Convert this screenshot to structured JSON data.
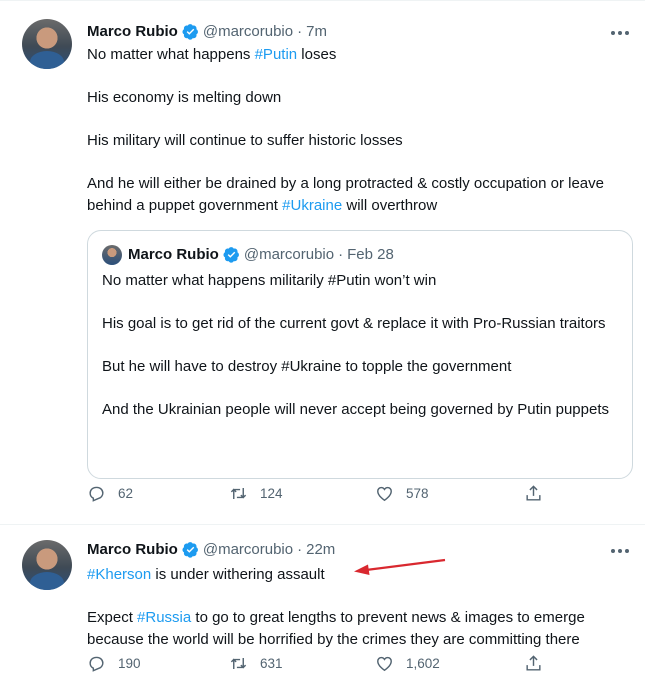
{
  "tweets": [
    {
      "author": {
        "name": "Marco Rubio",
        "handle": "@marcorubio",
        "time": "7m"
      },
      "lines": [
        {
          "parts": [
            {
              "t": "No matter what happens "
            },
            {
              "t": "#Putin",
              "link": true
            },
            {
              "t": " loses"
            }
          ]
        },
        {
          "parts": [
            {
              "t": "His economy is melting down"
            }
          ]
        },
        {
          "parts": [
            {
              "t": "His military will continue to suffer historic losses"
            }
          ]
        },
        {
          "parts": [
            {
              "t": "And he will either be drained by a long protracted & costly occupation or leave behind a puppet government "
            },
            {
              "t": "#Ukraine",
              "link": true
            },
            {
              "t": " will overthrow"
            }
          ]
        }
      ],
      "quote": {
        "author": {
          "name": "Marco Rubio",
          "handle": "@marcorubio",
          "time": "Feb 28"
        },
        "paragraphs": [
          "No matter what happens militarily #Putin won’t win",
          "His goal is to get rid of the current govt & replace it with Pro-Russian traitors",
          "But he will have to destroy #Ukraine to topple the government",
          "And the Ukrainian people will never accept being governed by Putin puppets"
        ]
      },
      "stats": {
        "replies": "62",
        "retweets": "124",
        "likes": "578"
      }
    },
    {
      "author": {
        "name": "Marco Rubio",
        "handle": "@marcorubio",
        "time": "22m"
      },
      "lines": [
        {
          "parts": [
            {
              "t": "#Kherson",
              "link": true
            },
            {
              "t": " is under withering assault"
            }
          ]
        },
        {
          "parts": [
            {
              "t": "Expect "
            },
            {
              "t": "#Russia",
              "link": true
            },
            {
              "t": " to go to great lengths to prevent news & images to emerge because the world will be horrified by the crimes they are committing there"
            }
          ]
        }
      ],
      "stats": {
        "replies": "190",
        "retweets": "631",
        "likes": "1,602"
      }
    }
  ],
  "colors": {
    "link": "#1d9bf0",
    "muted": "#536471",
    "border": "#cfd9de",
    "verified": "#1d9bf0",
    "annotation_arrow": "#d9282f"
  },
  "icons": [
    "verified-badge-icon",
    "more-icon",
    "reply-icon",
    "retweet-icon",
    "like-icon",
    "share-icon"
  ]
}
